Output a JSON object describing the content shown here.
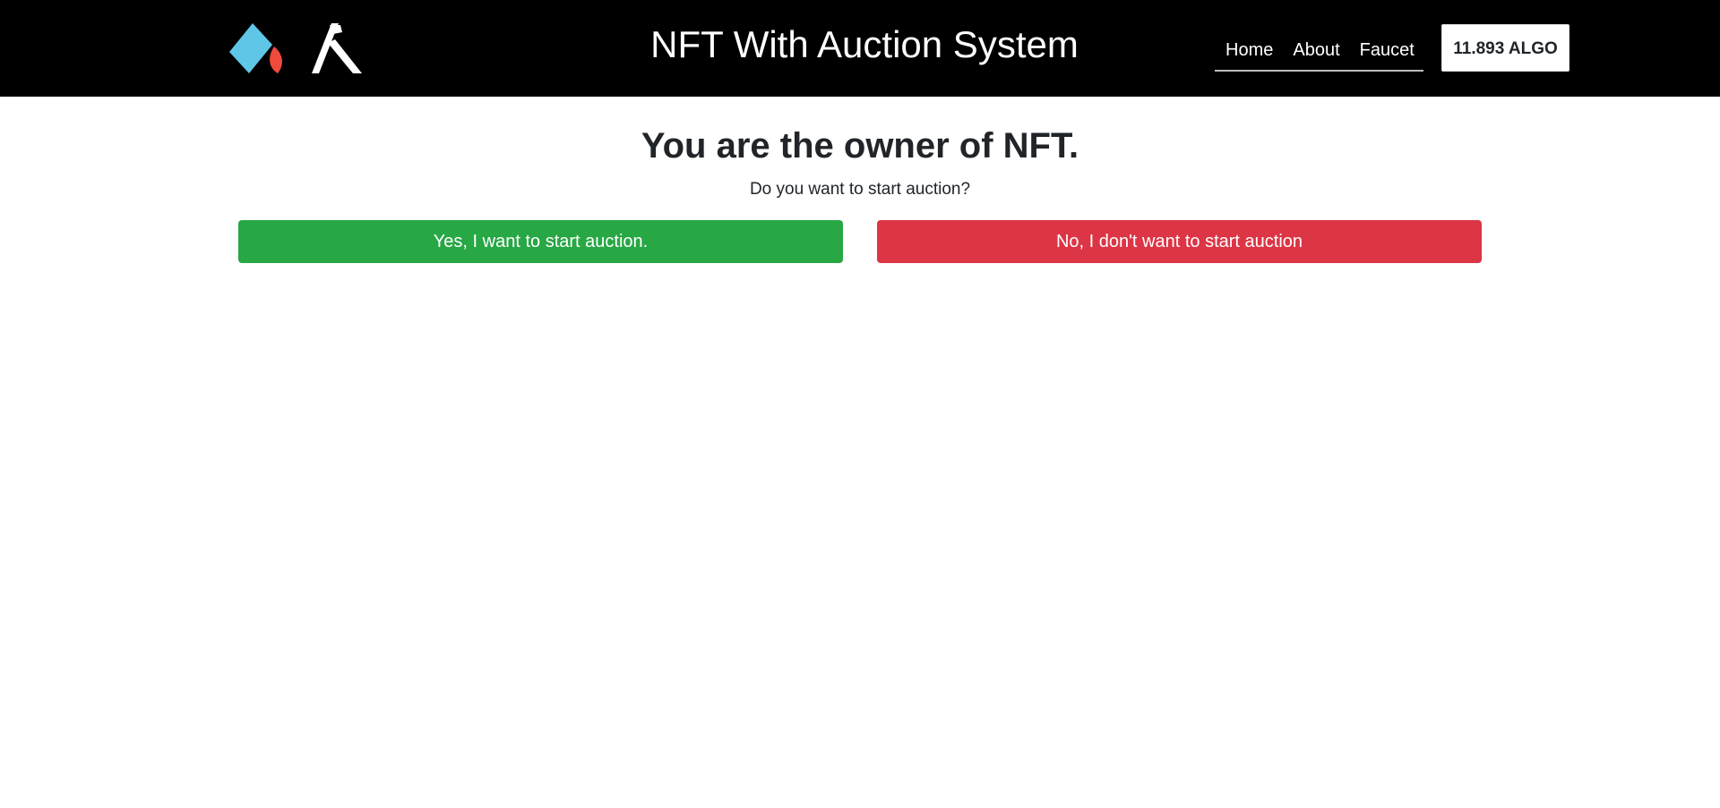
{
  "header": {
    "title": "NFT With Auction System",
    "nav": {
      "home": "Home",
      "about": "About",
      "faucet": "Faucet"
    },
    "balance": "11.893 ALGO",
    "logo_icons": [
      "reach-logo-icon",
      "algorand-logo-icon"
    ]
  },
  "main": {
    "heading": "You are the owner of NFT.",
    "question": "Do you want to start auction?",
    "yes_button": "Yes, I want to start auction.",
    "no_button": "No, I don't want to start auction"
  },
  "colors": {
    "navbar_bg": "#000000",
    "yes_button_bg": "#28a745",
    "no_button_bg": "#dc3545",
    "logo_blue": "#5fc6e8",
    "logo_red": "#ef4a3c"
  }
}
